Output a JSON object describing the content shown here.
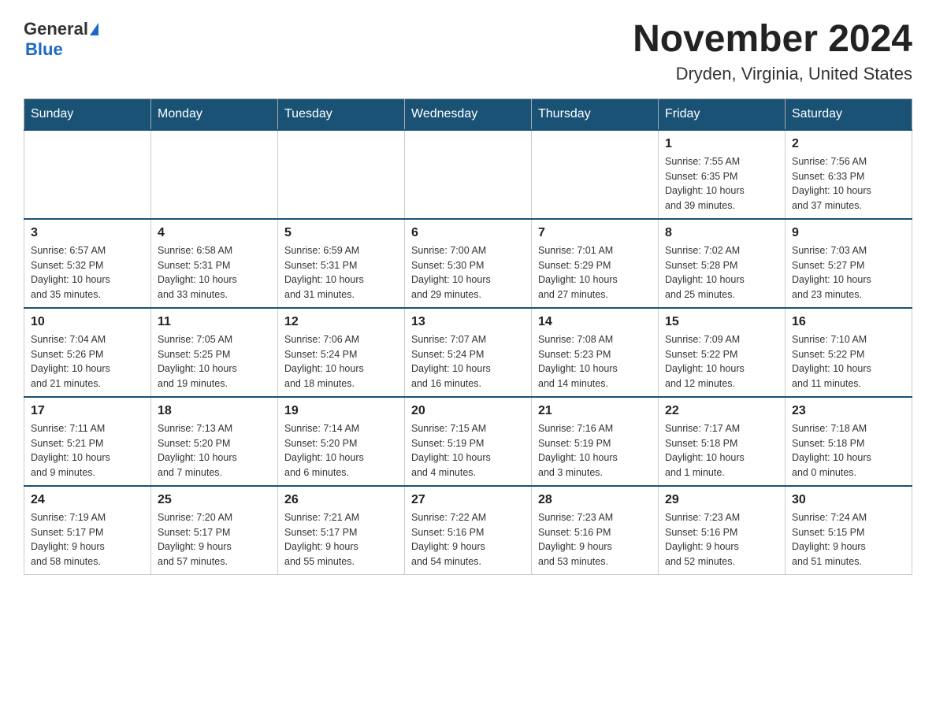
{
  "header": {
    "logo_general": "General",
    "logo_blue": "Blue",
    "month_title": "November 2024",
    "location": "Dryden, Virginia, United States"
  },
  "weekdays": [
    "Sunday",
    "Monday",
    "Tuesday",
    "Wednesday",
    "Thursday",
    "Friday",
    "Saturday"
  ],
  "weeks": [
    [
      {
        "day": "",
        "info": ""
      },
      {
        "day": "",
        "info": ""
      },
      {
        "day": "",
        "info": ""
      },
      {
        "day": "",
        "info": ""
      },
      {
        "day": "",
        "info": ""
      },
      {
        "day": "1",
        "info": "Sunrise: 7:55 AM\nSunset: 6:35 PM\nDaylight: 10 hours\nand 39 minutes."
      },
      {
        "day": "2",
        "info": "Sunrise: 7:56 AM\nSunset: 6:33 PM\nDaylight: 10 hours\nand 37 minutes."
      }
    ],
    [
      {
        "day": "3",
        "info": "Sunrise: 6:57 AM\nSunset: 5:32 PM\nDaylight: 10 hours\nand 35 minutes."
      },
      {
        "day": "4",
        "info": "Sunrise: 6:58 AM\nSunset: 5:31 PM\nDaylight: 10 hours\nand 33 minutes."
      },
      {
        "day": "5",
        "info": "Sunrise: 6:59 AM\nSunset: 5:31 PM\nDaylight: 10 hours\nand 31 minutes."
      },
      {
        "day": "6",
        "info": "Sunrise: 7:00 AM\nSunset: 5:30 PM\nDaylight: 10 hours\nand 29 minutes."
      },
      {
        "day": "7",
        "info": "Sunrise: 7:01 AM\nSunset: 5:29 PM\nDaylight: 10 hours\nand 27 minutes."
      },
      {
        "day": "8",
        "info": "Sunrise: 7:02 AM\nSunset: 5:28 PM\nDaylight: 10 hours\nand 25 minutes."
      },
      {
        "day": "9",
        "info": "Sunrise: 7:03 AM\nSunset: 5:27 PM\nDaylight: 10 hours\nand 23 minutes."
      }
    ],
    [
      {
        "day": "10",
        "info": "Sunrise: 7:04 AM\nSunset: 5:26 PM\nDaylight: 10 hours\nand 21 minutes."
      },
      {
        "day": "11",
        "info": "Sunrise: 7:05 AM\nSunset: 5:25 PM\nDaylight: 10 hours\nand 19 minutes."
      },
      {
        "day": "12",
        "info": "Sunrise: 7:06 AM\nSunset: 5:24 PM\nDaylight: 10 hours\nand 18 minutes."
      },
      {
        "day": "13",
        "info": "Sunrise: 7:07 AM\nSunset: 5:24 PM\nDaylight: 10 hours\nand 16 minutes."
      },
      {
        "day": "14",
        "info": "Sunrise: 7:08 AM\nSunset: 5:23 PM\nDaylight: 10 hours\nand 14 minutes."
      },
      {
        "day": "15",
        "info": "Sunrise: 7:09 AM\nSunset: 5:22 PM\nDaylight: 10 hours\nand 12 minutes."
      },
      {
        "day": "16",
        "info": "Sunrise: 7:10 AM\nSunset: 5:22 PM\nDaylight: 10 hours\nand 11 minutes."
      }
    ],
    [
      {
        "day": "17",
        "info": "Sunrise: 7:11 AM\nSunset: 5:21 PM\nDaylight: 10 hours\nand 9 minutes."
      },
      {
        "day": "18",
        "info": "Sunrise: 7:13 AM\nSunset: 5:20 PM\nDaylight: 10 hours\nand 7 minutes."
      },
      {
        "day": "19",
        "info": "Sunrise: 7:14 AM\nSunset: 5:20 PM\nDaylight: 10 hours\nand 6 minutes."
      },
      {
        "day": "20",
        "info": "Sunrise: 7:15 AM\nSunset: 5:19 PM\nDaylight: 10 hours\nand 4 minutes."
      },
      {
        "day": "21",
        "info": "Sunrise: 7:16 AM\nSunset: 5:19 PM\nDaylight: 10 hours\nand 3 minutes."
      },
      {
        "day": "22",
        "info": "Sunrise: 7:17 AM\nSunset: 5:18 PM\nDaylight: 10 hours\nand 1 minute."
      },
      {
        "day": "23",
        "info": "Sunrise: 7:18 AM\nSunset: 5:18 PM\nDaylight: 10 hours\nand 0 minutes."
      }
    ],
    [
      {
        "day": "24",
        "info": "Sunrise: 7:19 AM\nSunset: 5:17 PM\nDaylight: 9 hours\nand 58 minutes."
      },
      {
        "day": "25",
        "info": "Sunrise: 7:20 AM\nSunset: 5:17 PM\nDaylight: 9 hours\nand 57 minutes."
      },
      {
        "day": "26",
        "info": "Sunrise: 7:21 AM\nSunset: 5:17 PM\nDaylight: 9 hours\nand 55 minutes."
      },
      {
        "day": "27",
        "info": "Sunrise: 7:22 AM\nSunset: 5:16 PM\nDaylight: 9 hours\nand 54 minutes."
      },
      {
        "day": "28",
        "info": "Sunrise: 7:23 AM\nSunset: 5:16 PM\nDaylight: 9 hours\nand 53 minutes."
      },
      {
        "day": "29",
        "info": "Sunrise: 7:23 AM\nSunset: 5:16 PM\nDaylight: 9 hours\nand 52 minutes."
      },
      {
        "day": "30",
        "info": "Sunrise: 7:24 AM\nSunset: 5:15 PM\nDaylight: 9 hours\nand 51 minutes."
      }
    ]
  ]
}
